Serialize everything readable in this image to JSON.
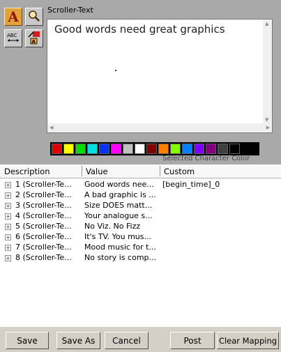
{
  "editor": {
    "label": "Scroller-Text",
    "text": "Good words need great graphics",
    "palette_label": "Selected Character Color"
  },
  "tools": [
    {
      "name": "font-icon",
      "glyph": "A",
      "active": true
    },
    {
      "name": "zoom-icon",
      "glyph": "🔍",
      "active": false
    },
    {
      "name": "text-width-icon",
      "glyph": "ABC",
      "active": false
    },
    {
      "name": "text-color-icon",
      "glyph": "A",
      "active": false
    }
  ],
  "palette": {
    "colors": [
      "#e00000",
      "#ffff00",
      "#00e000",
      "#00e0e0",
      "#0033ff",
      "#ff00ff",
      "#c0c0c0",
      "#ffffff",
      "#800000",
      "#ff8000",
      "#80ff00",
      "#0080ff",
      "#8000ff",
      "#800080",
      "#404040",
      "#000000"
    ]
  },
  "table": {
    "headers": {
      "description": "Description",
      "value": "Value",
      "custom": "Custom"
    },
    "rows": [
      {
        "description": "1 (Scroller-Te...",
        "value": "Good words nee...",
        "custom": "[begin_time]_0"
      },
      {
        "description": "2 (Scroller-Te...",
        "value": "A bad graphic is ...",
        "custom": ""
      },
      {
        "description": "3 (Scroller-Te...",
        "value": "Size DOES matt...",
        "custom": ""
      },
      {
        "description": "4 (Scroller-Te...",
        "value": "Your analogue s...",
        "custom": ""
      },
      {
        "description": "5 (Scroller-Te...",
        "value": "No Viz. No Fizz",
        "custom": ""
      },
      {
        "description": "6 (Scroller-Te...",
        "value": "It's TV. You mus...",
        "custom": ""
      },
      {
        "description": "7 (Scroller-Te...",
        "value": "Mood music for t...",
        "custom": ""
      },
      {
        "description": "8 (Scroller-Te...",
        "value": "No story is comp...",
        "custom": ""
      }
    ]
  },
  "buttons": {
    "save": "Save",
    "save_as": "Save As",
    "cancel": "Cancel",
    "post": "Post",
    "clear_mapping": "Clear Mapping"
  }
}
